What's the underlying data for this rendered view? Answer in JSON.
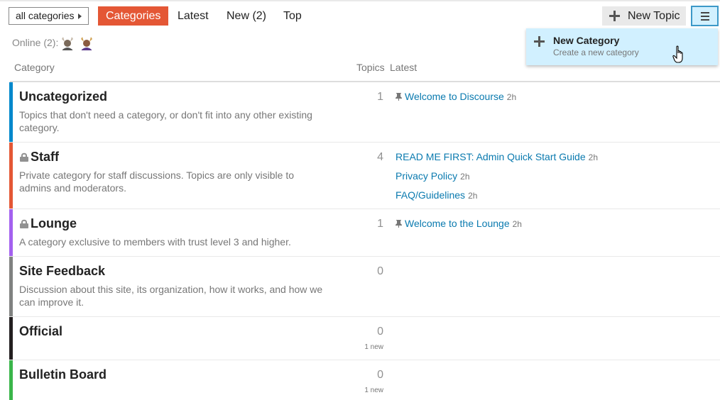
{
  "nav": {
    "category_dropdown": "all categories",
    "tabs": [
      {
        "label": "Categories",
        "active": true
      },
      {
        "label": "Latest"
      },
      {
        "label": "New (2)"
      },
      {
        "label": "Top"
      }
    ],
    "new_topic_label": "New Topic"
  },
  "dropdown": {
    "title": "New Category",
    "description": "Create a new category"
  },
  "online": {
    "label": "Online (2):"
  },
  "headers": {
    "category": "Category",
    "topics": "Topics",
    "latest": "Latest"
  },
  "categories": [
    {
      "name": "Uncategorized",
      "color": "#0088cc",
      "locked": false,
      "description": "Topics that don't need a category, or don't fit into any other existing category.",
      "topics": "1",
      "new": "",
      "latest": [
        {
          "title": "Welcome to Discourse",
          "age": "2h",
          "pinned": true
        }
      ]
    },
    {
      "name": "Staff",
      "color": "#e45735",
      "locked": true,
      "description": "Private category for staff discussions. Topics are only visible to admins and moderators.",
      "topics": "4",
      "new": "",
      "latest": [
        {
          "title": "READ ME FIRST: Admin Quick Start Guide",
          "age": "2h",
          "pinned": false
        },
        {
          "title": "Privacy Policy",
          "age": "2h",
          "pinned": false
        },
        {
          "title": "FAQ/Guidelines",
          "age": "2h",
          "pinned": false
        }
      ]
    },
    {
      "name": "Lounge",
      "color": "#a461ef",
      "locked": true,
      "description": "A category exclusive to members with trust level 3 and higher.",
      "topics": "1",
      "new": "",
      "latest": [
        {
          "title": "Welcome to the Lounge",
          "age": "2h",
          "pinned": true
        }
      ]
    },
    {
      "name": "Site Feedback",
      "color": "#808281",
      "locked": false,
      "description": "Discussion about this site, its organization, how it works, and how we can improve it.",
      "topics": "0",
      "new": "",
      "latest": []
    },
    {
      "name": "Official",
      "color": "#231f20",
      "locked": false,
      "description": "",
      "topics": "0",
      "new": "1 new",
      "latest": []
    },
    {
      "name": "Bulletin Board",
      "color": "#3ab54a",
      "locked": false,
      "description": "",
      "topics": "0",
      "new": "1 new",
      "latest": []
    }
  ],
  "colors": {
    "accent": "#e45735",
    "link": "#0a7aaf",
    "highlight": "#d1f0ff"
  }
}
